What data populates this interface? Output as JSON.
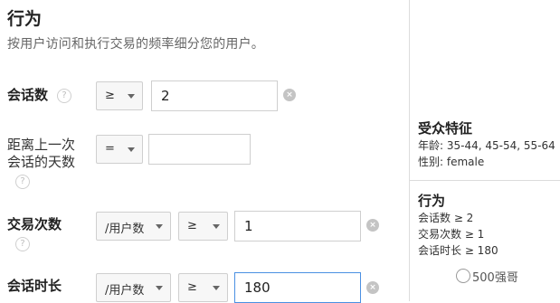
{
  "behavior": {
    "title": "行为",
    "description": "按用户访问和执行交易的频率细分您的用户。"
  },
  "rows": {
    "sessions": {
      "label": "会话数",
      "operator": "≥",
      "value": "2"
    },
    "days_since": {
      "label_line1": "距离上一次",
      "label_line2": "会话的天数",
      "operator": "=",
      "value": ""
    },
    "transactions": {
      "label": "交易次数",
      "scope": "/用户数",
      "operator": "≥",
      "value": "1"
    },
    "duration": {
      "label": "会话时长",
      "scope": "/用户数",
      "operator": "≥",
      "value": "180"
    }
  },
  "help_glyph": "?",
  "clear_glyph": "×",
  "summary": {
    "audience": {
      "title": "受众特征",
      "age": "年龄: 35-44, 45-54, 55-64",
      "gender": "性别: female"
    },
    "behavior": {
      "title": "行为",
      "sessions": "会话数 ≥ 2",
      "transactions": "交易次数 ≥ 1",
      "duration": "会话时长 ≥ 180"
    }
  },
  "watermark": "500强哥",
  "colors": {
    "focus_border": "#4a90e2",
    "divider": "#dcdcdc"
  }
}
